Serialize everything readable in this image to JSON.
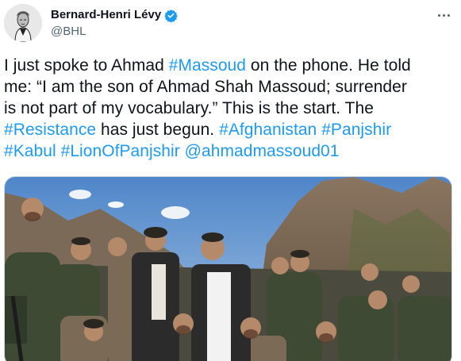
{
  "tweet": {
    "author": {
      "display_name": "Bernard-Henri Lévy",
      "handle": "@BHL",
      "verified": true
    },
    "more_icon": "more-horizontal-icon",
    "lines": [
      [
        {
          "t": "I just spoke to Ahmad ",
          "type": "text"
        },
        {
          "t": "#Massoud",
          "type": "hashtag"
        },
        {
          "t": " on the phone. He told",
          "type": "text"
        }
      ],
      [
        {
          "t": "me: “I am the son of Ahmad Shah Massoud; surrender",
          "type": "text"
        }
      ],
      [
        {
          "t": "is not part of my vocabulary.” This is the start. The",
          "type": "text"
        }
      ],
      [
        {
          "t": "#Resistance",
          "type": "hashtag"
        },
        {
          "t": " has just begun. ",
          "type": "text"
        },
        {
          "t": "#Afghanistan",
          "type": "hashtag"
        },
        {
          "t": " ",
          "type": "text"
        },
        {
          "t": "#Panjshir",
          "type": "hashtag"
        }
      ],
      [
        {
          "t": "#Kabul",
          "type": "hashtag"
        },
        {
          "t": " ",
          "type": "text"
        },
        {
          "t": "#LionOfPanjshir",
          "type": "hashtag"
        },
        {
          "t": " ",
          "type": "text"
        },
        {
          "t": "@ahmadmassoud01",
          "type": "mention"
        }
      ]
    ],
    "media": {
      "kind": "photo",
      "subject": "group of fighters in a mountain valley"
    }
  },
  "colors": {
    "link": "#1d9bf0",
    "text": "#0f1419",
    "secondary": "#536471",
    "verified": "#1d9bf0"
  }
}
